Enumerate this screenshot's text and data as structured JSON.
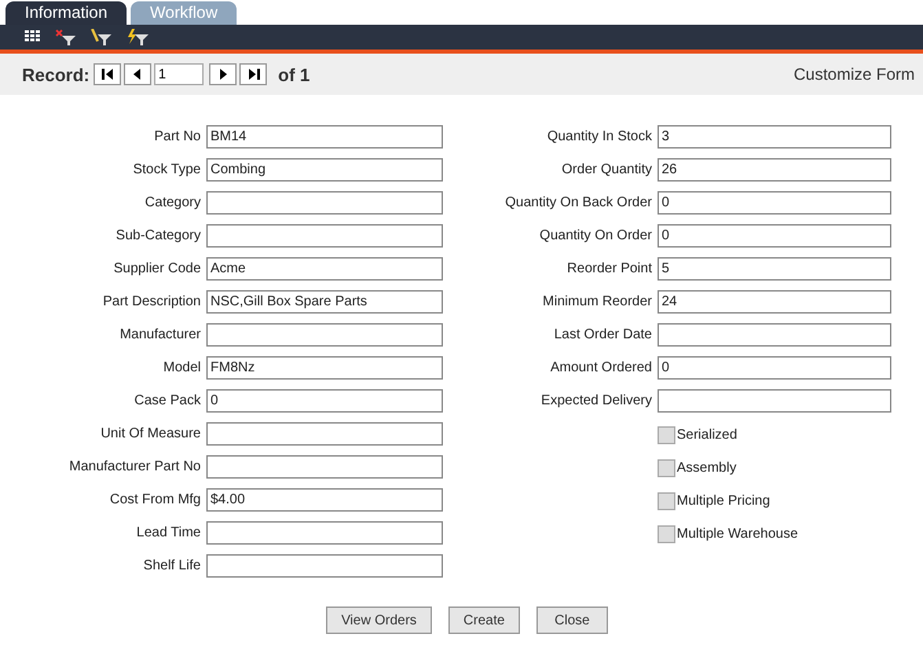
{
  "tabs": [
    {
      "label": "Information",
      "selected": true
    },
    {
      "label": "Workflow",
      "selected": false
    }
  ],
  "record_bar": {
    "label": "Record:",
    "value": "1",
    "total": "of 1",
    "customize_link": "Customize Form"
  },
  "left_fields": [
    {
      "label": "Part No",
      "value": "BM14"
    },
    {
      "label": "Stock Type",
      "value": "Combing"
    },
    {
      "label": "Category"
    },
    {
      "label": "Sub-Category"
    },
    {
      "label": "Supplier Code",
      "value": "Acme"
    },
    {
      "label": "Part Description",
      "value": "NSC,Gill Box Spare Parts"
    },
    {
      "label": "Manufacturer"
    },
    {
      "label": "Model",
      "value": "FM8Nz"
    },
    {
      "label": "Case Pack",
      "value": "0"
    },
    {
      "label": "Unit Of Measure"
    },
    {
      "label": "Manufacturer Part No"
    },
    {
      "label": "Cost From Mfg",
      "value": "$4.00"
    },
    {
      "label": "Lead Time"
    },
    {
      "label": "Shelf Life"
    }
  ],
  "right_fields": [
    {
      "label": "Quantity In Stock",
      "value": "3"
    },
    {
      "label": "Order Quantity",
      "value": "26"
    },
    {
      "label": "Quantity On Back Order",
      "value": "0"
    },
    {
      "label": "Quantity On Order",
      "value": "0"
    },
    {
      "label": "Reorder Point",
      "value": "5"
    },
    {
      "label": "Minimum Reorder",
      "value": "24"
    },
    {
      "label": "Last Order Date"
    },
    {
      "label": "Amount Ordered",
      "value": "0"
    },
    {
      "label": "Expected Delivery"
    }
  ],
  "checkboxes": [
    {
      "label": "Serialized",
      "checked": false
    },
    {
      "label": "Assembly",
      "checked": false
    },
    {
      "label": "Multiple Pricing",
      "checked": false
    },
    {
      "label": "Multiple Warehouse",
      "checked": false
    }
  ],
  "buttons": [
    "View Orders",
    "Create",
    "Close"
  ]
}
